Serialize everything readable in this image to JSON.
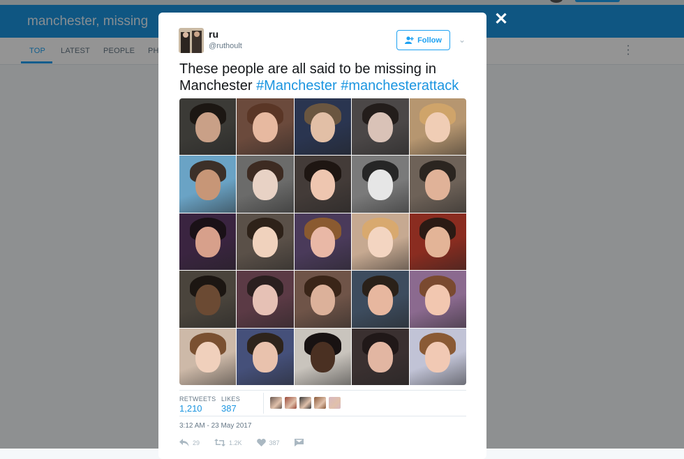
{
  "background": {
    "search_query": "manchester, missing",
    "tabs": [
      {
        "label": "TOP"
      },
      {
        "label": "LATEST"
      },
      {
        "label": "PEOPLE"
      },
      {
        "label": "PH"
      }
    ],
    "more_menu_icon": "vertical-dots-icon"
  },
  "modal": {
    "close_icon": "close-icon",
    "author": {
      "name": "ru",
      "handle": "@ruthoult"
    },
    "follow_label": "Follow",
    "caret_icon": "chevron-down-icon",
    "text_plain": "These people are all said to be missing in Manchester ",
    "hashtags": [
      "#Manchester",
      "#manchesterattack"
    ],
    "media_photo_count": 25,
    "stats": {
      "retweets_label": "RETWEETS",
      "retweets_value": "1,210",
      "likes_label": "LIKES",
      "likes_value": "387"
    },
    "likers_count": 5,
    "timestamp": "3:12 AM - 23 May 2017",
    "actions": [
      {
        "icon": "reply-icon",
        "count": "29"
      },
      {
        "icon": "retweet-icon",
        "count": "1.2K"
      },
      {
        "icon": "heart-icon",
        "count": "387"
      },
      {
        "icon": "direct-message-icon",
        "count": ""
      }
    ]
  },
  "colors": {
    "brand_blue": "#1da1f2",
    "link_blue": "#1b95e0",
    "header_blue": "#1b95e0"
  }
}
